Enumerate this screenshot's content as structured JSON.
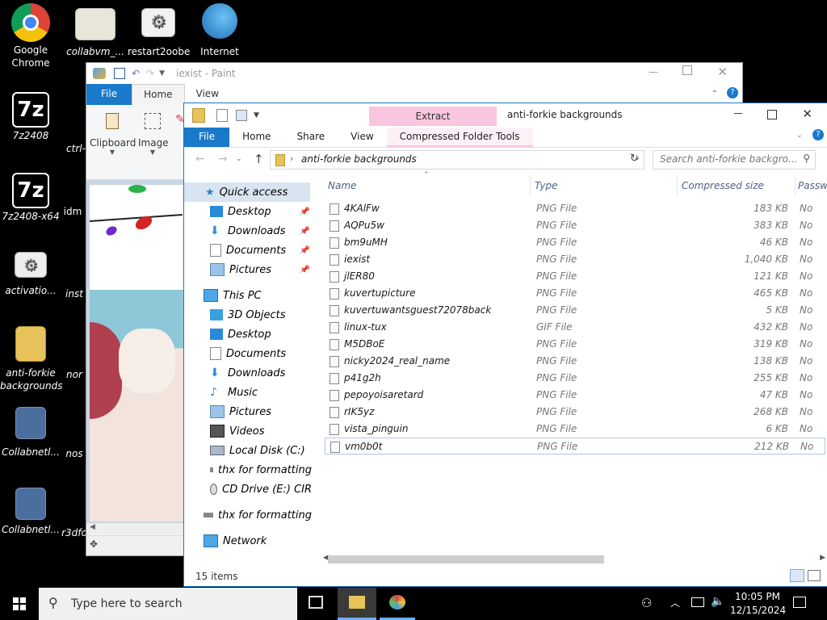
{
  "desktop": {
    "icons": [
      {
        "id": "chrome",
        "label": "Google Chrome"
      },
      {
        "id": "collabvm",
        "label": "collabvm_..."
      },
      {
        "id": "restart2oobe",
        "label": "restart2oobe"
      },
      {
        "id": "internet",
        "label": "Internet"
      },
      {
        "id": "7z2408",
        "label": "7z2408"
      },
      {
        "id": "7z2408x64",
        "label": "7z2408-x64"
      },
      {
        "id": "idm",
        "label": "idm"
      },
      {
        "id": "activation",
        "label": "activatio..."
      },
      {
        "id": "inst",
        "label": "inst"
      },
      {
        "id": "antiforkie",
        "label": "anti-forkie backgrounds"
      },
      {
        "id": "nor",
        "label": "nor"
      },
      {
        "id": "collabnet1",
        "label": "Collabnetl..."
      },
      {
        "id": "nos",
        "label": "nos"
      },
      {
        "id": "collabnet2",
        "label": "Collabnetl..."
      },
      {
        "id": "r3df",
        "label": "r3dfo"
      },
      {
        "id": "ctrl",
        "label": "ctrl-"
      }
    ]
  },
  "paint": {
    "title": "iexist - Paint",
    "tabs": {
      "file": "File",
      "home": "Home",
      "view": "View"
    },
    "groups": {
      "clipboard": "Clipboard",
      "image": "Image"
    }
  },
  "explorer": {
    "title": "anti-forkie backgrounds",
    "context_tab": "Extract",
    "tabs": {
      "file": "File",
      "home": "Home",
      "share": "Share",
      "view": "View",
      "tools": "Compressed Folder Tools"
    },
    "address": "anti-forkie backgrounds",
    "search_placeholder": "Search anti-forkie backgro...",
    "nav": {
      "quick_access": "Quick access",
      "qa_items": [
        "Desktop",
        "Downloads",
        "Documents",
        "Pictures"
      ],
      "this_pc": "This PC",
      "pc_items": [
        "3D Objects",
        "Desktop",
        "Documents",
        "Downloads",
        "Music",
        "Pictures",
        "Videos",
        "Local Disk (C:)",
        "thx for formatting",
        "CD Drive (E:) CIR"
      ],
      "drive": "thx for formatting",
      "network": "Network"
    },
    "columns": {
      "name": "Name",
      "type": "Type",
      "size": "Compressed size",
      "password": "Passw"
    },
    "files": [
      {
        "name": "4KAlFw",
        "type": "PNG File",
        "size": "183 KB",
        "pw": "No"
      },
      {
        "name": "AQPu5w",
        "type": "PNG File",
        "size": "383 KB",
        "pw": "No"
      },
      {
        "name": "bm9uMH",
        "type": "PNG File",
        "size": "46 KB",
        "pw": "No"
      },
      {
        "name": "iexist",
        "type": "PNG File",
        "size": "1,040 KB",
        "pw": "No"
      },
      {
        "name": "jlER80",
        "type": "PNG File",
        "size": "121 KB",
        "pw": "No"
      },
      {
        "name": "kuvertupicture",
        "type": "PNG File",
        "size": "465 KB",
        "pw": "No"
      },
      {
        "name": "kuvertuwantsguest72078back",
        "type": "PNG File",
        "size": "5 KB",
        "pw": "No"
      },
      {
        "name": "linux-tux",
        "type": "GIF File",
        "size": "432 KB",
        "pw": "No"
      },
      {
        "name": "M5DBoE",
        "type": "PNG File",
        "size": "319 KB",
        "pw": "No"
      },
      {
        "name": "nicky2024_real_name",
        "type": "PNG File",
        "size": "138 KB",
        "pw": "No"
      },
      {
        "name": "p41g2h",
        "type": "PNG File",
        "size": "255 KB",
        "pw": "No"
      },
      {
        "name": "pepoyoisaretard",
        "type": "PNG File",
        "size": "47 KB",
        "pw": "No"
      },
      {
        "name": "rIK5yz",
        "type": "PNG File",
        "size": "268 KB",
        "pw": "No"
      },
      {
        "name": "vista_pinguin",
        "type": "PNG File",
        "size": "6 KB",
        "pw": "No"
      },
      {
        "name": "vm0b0t",
        "type": "PNG File",
        "size": "212 KB",
        "pw": "No"
      }
    ],
    "status": "15 items"
  },
  "taskbar": {
    "search_placeholder": "Type here to search",
    "time": "10:05 PM",
    "date": "12/15/2024"
  },
  "colors": {
    "accent": "#1979ca",
    "extract_tab": "#f8c6df"
  }
}
